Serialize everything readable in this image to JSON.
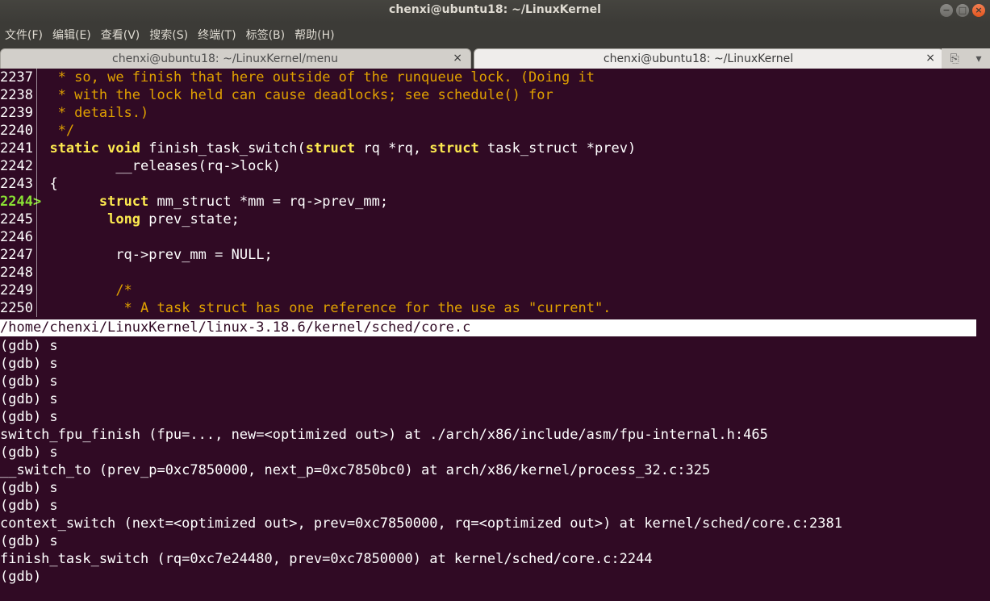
{
  "window": {
    "title": "chenxi@ubuntu18: ~/LinuxKernel",
    "buttons": {
      "minimize": "−",
      "maximize": "□",
      "close": "×"
    }
  },
  "menu": [
    "文件(F)",
    "编辑(E)",
    "查看(V)",
    "搜索(S)",
    "终端(T)",
    "标签(B)",
    "帮助(H)"
  ],
  "tabs": [
    {
      "label": "chenxi@ubuntu18: ~/LinuxKernel/menu",
      "close": "×",
      "active": false
    },
    {
      "label": "chenxi@ubuntu18: ~/LinuxKernel",
      "close": "×",
      "active": true
    }
  ],
  "tab_tools": {
    "new_tab_icon": "terminal-plus-icon",
    "menu_icon": "chevron-down-icon",
    "new_tab_glyph": "⎘",
    "menu_glyph": "▾"
  },
  "source": [
    {
      "num": "2237",
      "arrow": "",
      "code": " * so, we finish that here outside of the runqueue lock. (Doing it",
      "type": "comment"
    },
    {
      "num": "2238",
      "arrow": "",
      "code": " * with the lock held can cause deadlocks; see schedule() for",
      "type": "comment"
    },
    {
      "num": "2239",
      "arrow": "",
      "code": " * details.)",
      "type": "comment"
    },
    {
      "num": "2240",
      "arrow": "",
      "code": " */",
      "type": "comment"
    },
    {
      "num": "2241",
      "arrow": "",
      "kw1": "static void",
      "t1": " finish_task_switch(",
      "kw2": "struct",
      "t2": " rq *rq, ",
      "kw3": "struct",
      "t3": " task_struct *prev)",
      "type": "sig"
    },
    {
      "num": "2242",
      "arrow": "",
      "code": "        __releases(rq->lock)",
      "type": "plain"
    },
    {
      "num": "2243",
      "arrow": "",
      "code": "{",
      "type": "plain"
    },
    {
      "num": "2244",
      "arrow": ">",
      "kw1": "struct",
      "t1": " mm_struct *mm = rq->prev_mm;",
      "type": "kwline"
    },
    {
      "num": "2245",
      "arrow": "",
      "kw1": "long",
      "t1": " prev_state;",
      "type": "kwline"
    },
    {
      "num": "2246",
      "arrow": "",
      "code": "",
      "type": "plain"
    },
    {
      "num": "2247",
      "arrow": "",
      "code": "        rq->prev_mm = NULL;",
      "type": "plain"
    },
    {
      "num": "2248",
      "arrow": "",
      "code": "",
      "type": "plain"
    },
    {
      "num": "2249",
      "arrow": "",
      "code": "        /*",
      "type": "comment"
    },
    {
      "num": "2250",
      "arrow": "",
      "code": "         * A task struct has one reference for the use as \"current\".",
      "type": "comment"
    }
  ],
  "source_file": "/home/chenxi/LinuxKernel/linux-3.18.6/kernel/sched/core.c",
  "console": [
    "(gdb) s",
    "(gdb) s",
    "(gdb) s",
    "(gdb) s",
    "(gdb) s",
    "switch_fpu_finish (fpu=..., new=<optimized out>) at ./arch/x86/include/asm/fpu-internal.h:465",
    "(gdb) s",
    "__switch_to (prev_p=0xc7850000, next_p=0xc7850bc0) at arch/x86/kernel/process_32.c:325",
    "(gdb) s",
    "(gdb) s",
    "context_switch (next=<optimized out>, prev=0xc7850000, rq=<optimized out>) at kernel/sched/core.c:2381",
    "(gdb) s",
    "finish_task_switch (rq=0xc7e24480, prev=0xc7850000) at kernel/sched/core.c:2244",
    "(gdb) "
  ]
}
